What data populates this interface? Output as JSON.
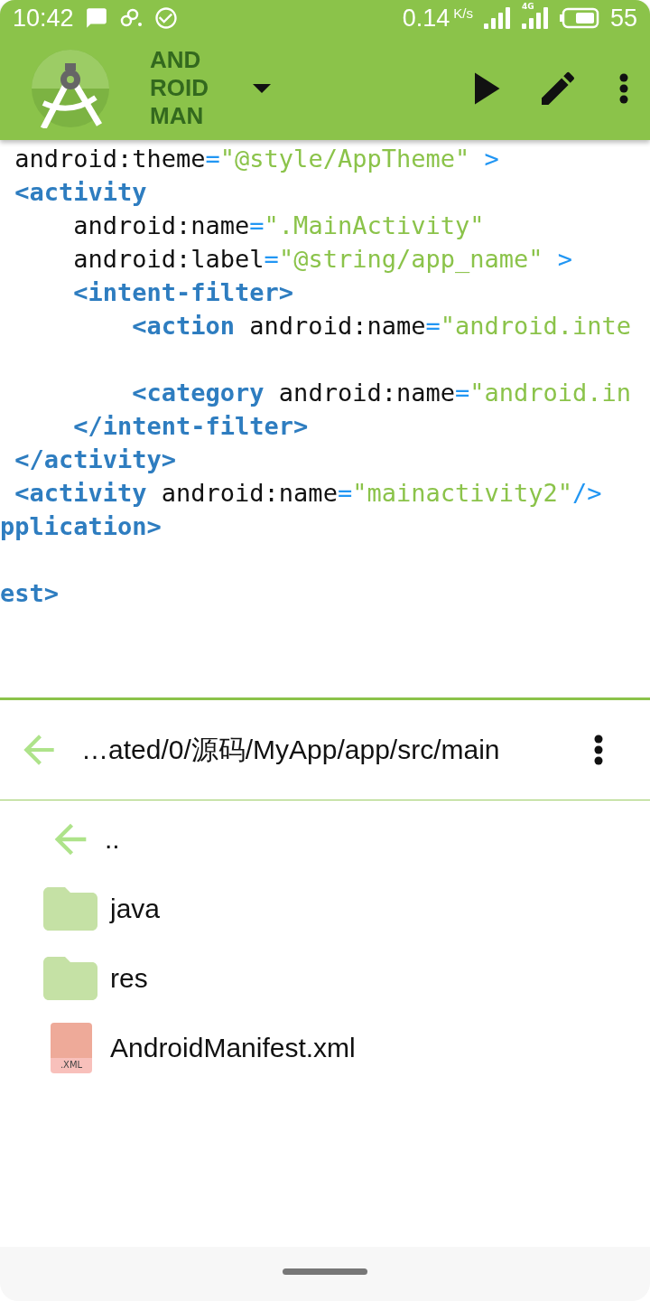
{
  "status_bar": {
    "time": "10:42",
    "speed": "0.14",
    "speed_unit": "K/s",
    "network": "4G",
    "battery": "55"
  },
  "toolbar": {
    "title": "AND ROID MAN"
  },
  "editor": {
    "lines": [
      {
        "kind": "code",
        "tokens": [
          {
            "kind": "attr",
            "text": " android:theme"
          },
          {
            "kind": "punct",
            "text": "="
          },
          {
            "kind": "string",
            "text": "\"@style/AppTheme\""
          },
          {
            "kind": "punct",
            "text": " >"
          }
        ]
      },
      {
        "kind": "code",
        "tokens": [
          {
            "kind": "tag",
            "text": " <activity"
          }
        ]
      },
      {
        "kind": "code",
        "tokens": [
          {
            "kind": "attr",
            "text": "     android:name"
          },
          {
            "kind": "punct",
            "text": "="
          },
          {
            "kind": "string",
            "text": "\".MainActivity\""
          }
        ]
      },
      {
        "kind": "code",
        "tokens": [
          {
            "kind": "attr",
            "text": "     android:label"
          },
          {
            "kind": "punct",
            "text": "="
          },
          {
            "kind": "string",
            "text": "\"@string/app_name\""
          },
          {
            "kind": "punct",
            "text": " >"
          }
        ]
      },
      {
        "kind": "code",
        "tokens": [
          {
            "kind": "tag",
            "text": "     <intent-filter>"
          }
        ]
      },
      {
        "kind": "code",
        "tokens": [
          {
            "kind": "tag",
            "text": "         <action"
          },
          {
            "kind": "attr",
            "text": " android:name"
          },
          {
            "kind": "punct",
            "text": "="
          },
          {
            "kind": "string",
            "text": "\"android.inte"
          }
        ]
      },
      {
        "kind": "blank"
      },
      {
        "kind": "code",
        "tokens": [
          {
            "kind": "tag",
            "text": "         <category"
          },
          {
            "kind": "attr",
            "text": " android:name"
          },
          {
            "kind": "punct",
            "text": "="
          },
          {
            "kind": "string",
            "text": "\"android.in"
          }
        ]
      },
      {
        "kind": "code",
        "tokens": [
          {
            "kind": "tag",
            "text": "     </intent-filter>"
          }
        ]
      },
      {
        "kind": "code",
        "tokens": [
          {
            "kind": "tag",
            "text": " </activity>"
          }
        ]
      },
      {
        "kind": "code",
        "tokens": [
          {
            "kind": "tag",
            "text": " <activity"
          },
          {
            "kind": "attr",
            "text": " android:name"
          },
          {
            "kind": "punct",
            "text": "="
          },
          {
            "kind": "string",
            "text": "\"mainactivity2\""
          },
          {
            "kind": "punct",
            "text": "/>"
          }
        ]
      },
      {
        "kind": "code",
        "tokens": [
          {
            "kind": "tag",
            "text": "pplication>"
          }
        ]
      },
      {
        "kind": "blank"
      },
      {
        "kind": "code",
        "tokens": [
          {
            "kind": "tag",
            "text": "est>"
          }
        ]
      }
    ]
  },
  "file_browser": {
    "path": "…ated/0/源码/MyApp/app/src/main",
    "items": [
      {
        "kind": "up",
        "name": ".."
      },
      {
        "kind": "folder",
        "name": "java"
      },
      {
        "kind": "folder",
        "name": "res"
      },
      {
        "kind": "file",
        "name": "AndroidManifest.xml",
        "badge": ".XML"
      }
    ]
  }
}
